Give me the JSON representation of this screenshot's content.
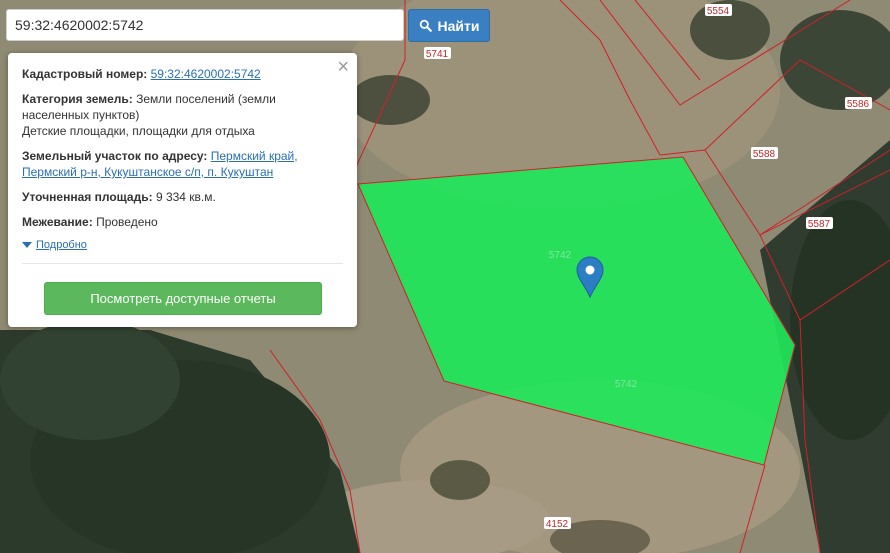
{
  "search": {
    "value": "59:32:4620002:5742",
    "button_label": "Найти"
  },
  "info": {
    "cadastral_label": "Кадастровый номер:",
    "cadastral_value": "59:32:4620002:5742",
    "category_label": "Категория земель:",
    "category_value": "Земли поселений (земли населенных пунктов)",
    "usage_value": "Детские площадки, площадки для отдыха",
    "address_label": "Земельный участок по адресу:",
    "address_value": "Пермский край, Пермский р-н, Кукуштанское с/п, п. Кукуштан",
    "area_label": "Уточненная площадь:",
    "area_value": "9 334 кв.м.",
    "survey_label": "Межевание:",
    "survey_value": "Проведено",
    "more_label": "Подробно",
    "report_button": "Посмотреть доступные отчеты",
    "close": "×"
  },
  "map": {
    "parcel_labels": [
      "5554",
      "5741",
      "5586",
      "5588",
      "5587",
      "5742",
      "5742",
      "4152"
    ],
    "highlight_color": "#1fe65a",
    "boundary_color": "#d0202a",
    "marker_color": "#2b7ec4"
  }
}
